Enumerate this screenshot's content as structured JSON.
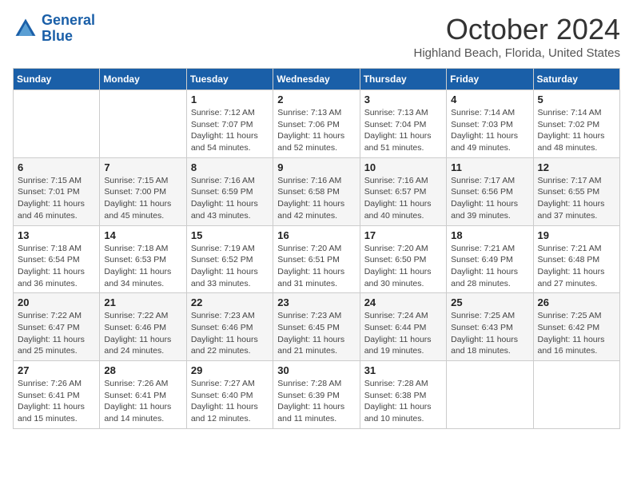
{
  "logo": {
    "line1": "General",
    "line2": "Blue"
  },
  "title": "October 2024",
  "location": "Highland Beach, Florida, United States",
  "days_header": [
    "Sunday",
    "Monday",
    "Tuesday",
    "Wednesday",
    "Thursday",
    "Friday",
    "Saturday"
  ],
  "weeks": [
    [
      {
        "day": "",
        "sunrise": "",
        "sunset": "",
        "daylight": ""
      },
      {
        "day": "",
        "sunrise": "",
        "sunset": "",
        "daylight": ""
      },
      {
        "day": "1",
        "sunrise": "Sunrise: 7:12 AM",
        "sunset": "Sunset: 7:07 PM",
        "daylight": "Daylight: 11 hours and 54 minutes."
      },
      {
        "day": "2",
        "sunrise": "Sunrise: 7:13 AM",
        "sunset": "Sunset: 7:06 PM",
        "daylight": "Daylight: 11 hours and 52 minutes."
      },
      {
        "day": "3",
        "sunrise": "Sunrise: 7:13 AM",
        "sunset": "Sunset: 7:04 PM",
        "daylight": "Daylight: 11 hours and 51 minutes."
      },
      {
        "day": "4",
        "sunrise": "Sunrise: 7:14 AM",
        "sunset": "Sunset: 7:03 PM",
        "daylight": "Daylight: 11 hours and 49 minutes."
      },
      {
        "day": "5",
        "sunrise": "Sunrise: 7:14 AM",
        "sunset": "Sunset: 7:02 PM",
        "daylight": "Daylight: 11 hours and 48 minutes."
      }
    ],
    [
      {
        "day": "6",
        "sunrise": "Sunrise: 7:15 AM",
        "sunset": "Sunset: 7:01 PM",
        "daylight": "Daylight: 11 hours and 46 minutes."
      },
      {
        "day": "7",
        "sunrise": "Sunrise: 7:15 AM",
        "sunset": "Sunset: 7:00 PM",
        "daylight": "Daylight: 11 hours and 45 minutes."
      },
      {
        "day": "8",
        "sunrise": "Sunrise: 7:16 AM",
        "sunset": "Sunset: 6:59 PM",
        "daylight": "Daylight: 11 hours and 43 minutes."
      },
      {
        "day": "9",
        "sunrise": "Sunrise: 7:16 AM",
        "sunset": "Sunset: 6:58 PM",
        "daylight": "Daylight: 11 hours and 42 minutes."
      },
      {
        "day": "10",
        "sunrise": "Sunrise: 7:16 AM",
        "sunset": "Sunset: 6:57 PM",
        "daylight": "Daylight: 11 hours and 40 minutes."
      },
      {
        "day": "11",
        "sunrise": "Sunrise: 7:17 AM",
        "sunset": "Sunset: 6:56 PM",
        "daylight": "Daylight: 11 hours and 39 minutes."
      },
      {
        "day": "12",
        "sunrise": "Sunrise: 7:17 AM",
        "sunset": "Sunset: 6:55 PM",
        "daylight": "Daylight: 11 hours and 37 minutes."
      }
    ],
    [
      {
        "day": "13",
        "sunrise": "Sunrise: 7:18 AM",
        "sunset": "Sunset: 6:54 PM",
        "daylight": "Daylight: 11 hours and 36 minutes."
      },
      {
        "day": "14",
        "sunrise": "Sunrise: 7:18 AM",
        "sunset": "Sunset: 6:53 PM",
        "daylight": "Daylight: 11 hours and 34 minutes."
      },
      {
        "day": "15",
        "sunrise": "Sunrise: 7:19 AM",
        "sunset": "Sunset: 6:52 PM",
        "daylight": "Daylight: 11 hours and 33 minutes."
      },
      {
        "day": "16",
        "sunrise": "Sunrise: 7:20 AM",
        "sunset": "Sunset: 6:51 PM",
        "daylight": "Daylight: 11 hours and 31 minutes."
      },
      {
        "day": "17",
        "sunrise": "Sunrise: 7:20 AM",
        "sunset": "Sunset: 6:50 PM",
        "daylight": "Daylight: 11 hours and 30 minutes."
      },
      {
        "day": "18",
        "sunrise": "Sunrise: 7:21 AM",
        "sunset": "Sunset: 6:49 PM",
        "daylight": "Daylight: 11 hours and 28 minutes."
      },
      {
        "day": "19",
        "sunrise": "Sunrise: 7:21 AM",
        "sunset": "Sunset: 6:48 PM",
        "daylight": "Daylight: 11 hours and 27 minutes."
      }
    ],
    [
      {
        "day": "20",
        "sunrise": "Sunrise: 7:22 AM",
        "sunset": "Sunset: 6:47 PM",
        "daylight": "Daylight: 11 hours and 25 minutes."
      },
      {
        "day": "21",
        "sunrise": "Sunrise: 7:22 AM",
        "sunset": "Sunset: 6:46 PM",
        "daylight": "Daylight: 11 hours and 24 minutes."
      },
      {
        "day": "22",
        "sunrise": "Sunrise: 7:23 AM",
        "sunset": "Sunset: 6:46 PM",
        "daylight": "Daylight: 11 hours and 22 minutes."
      },
      {
        "day": "23",
        "sunrise": "Sunrise: 7:23 AM",
        "sunset": "Sunset: 6:45 PM",
        "daylight": "Daylight: 11 hours and 21 minutes."
      },
      {
        "day": "24",
        "sunrise": "Sunrise: 7:24 AM",
        "sunset": "Sunset: 6:44 PM",
        "daylight": "Daylight: 11 hours and 19 minutes."
      },
      {
        "day": "25",
        "sunrise": "Sunrise: 7:25 AM",
        "sunset": "Sunset: 6:43 PM",
        "daylight": "Daylight: 11 hours and 18 minutes."
      },
      {
        "day": "26",
        "sunrise": "Sunrise: 7:25 AM",
        "sunset": "Sunset: 6:42 PM",
        "daylight": "Daylight: 11 hours and 16 minutes."
      }
    ],
    [
      {
        "day": "27",
        "sunrise": "Sunrise: 7:26 AM",
        "sunset": "Sunset: 6:41 PM",
        "daylight": "Daylight: 11 hours and 15 minutes."
      },
      {
        "day": "28",
        "sunrise": "Sunrise: 7:26 AM",
        "sunset": "Sunset: 6:41 PM",
        "daylight": "Daylight: 11 hours and 14 minutes."
      },
      {
        "day": "29",
        "sunrise": "Sunrise: 7:27 AM",
        "sunset": "Sunset: 6:40 PM",
        "daylight": "Daylight: 11 hours and 12 minutes."
      },
      {
        "day": "30",
        "sunrise": "Sunrise: 7:28 AM",
        "sunset": "Sunset: 6:39 PM",
        "daylight": "Daylight: 11 hours and 11 minutes."
      },
      {
        "day": "31",
        "sunrise": "Sunrise: 7:28 AM",
        "sunset": "Sunset: 6:38 PM",
        "daylight": "Daylight: 11 hours and 10 minutes."
      },
      {
        "day": "",
        "sunrise": "",
        "sunset": "",
        "daylight": ""
      },
      {
        "day": "",
        "sunrise": "",
        "sunset": "",
        "daylight": ""
      }
    ]
  ]
}
